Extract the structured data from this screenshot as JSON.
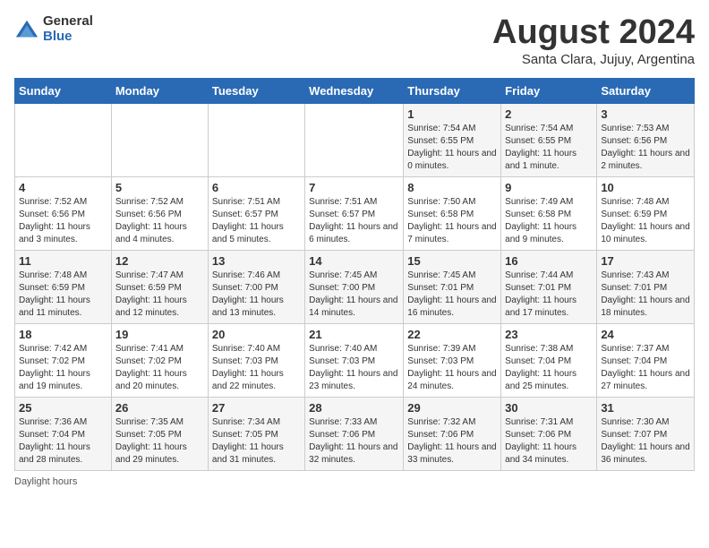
{
  "header": {
    "logo": {
      "general": "General",
      "blue": "Blue"
    },
    "title": "August 2024",
    "location": "Santa Clara, Jujuy, Argentina"
  },
  "days_of_week": [
    "Sunday",
    "Monday",
    "Tuesday",
    "Wednesday",
    "Thursday",
    "Friday",
    "Saturday"
  ],
  "footer": {
    "note": "Daylight hours"
  },
  "weeks": [
    {
      "days": [
        {
          "num": "",
          "info": ""
        },
        {
          "num": "",
          "info": ""
        },
        {
          "num": "",
          "info": ""
        },
        {
          "num": "",
          "info": ""
        },
        {
          "num": "1",
          "info": "Sunrise: 7:54 AM\nSunset: 6:55 PM\nDaylight: 11 hours and 0 minutes."
        },
        {
          "num": "2",
          "info": "Sunrise: 7:54 AM\nSunset: 6:55 PM\nDaylight: 11 hours and 1 minute."
        },
        {
          "num": "3",
          "info": "Sunrise: 7:53 AM\nSunset: 6:56 PM\nDaylight: 11 hours and 2 minutes."
        }
      ]
    },
    {
      "days": [
        {
          "num": "4",
          "info": "Sunrise: 7:52 AM\nSunset: 6:56 PM\nDaylight: 11 hours and 3 minutes."
        },
        {
          "num": "5",
          "info": "Sunrise: 7:52 AM\nSunset: 6:56 PM\nDaylight: 11 hours and 4 minutes."
        },
        {
          "num": "6",
          "info": "Sunrise: 7:51 AM\nSunset: 6:57 PM\nDaylight: 11 hours and 5 minutes."
        },
        {
          "num": "7",
          "info": "Sunrise: 7:51 AM\nSunset: 6:57 PM\nDaylight: 11 hours and 6 minutes."
        },
        {
          "num": "8",
          "info": "Sunrise: 7:50 AM\nSunset: 6:58 PM\nDaylight: 11 hours and 7 minutes."
        },
        {
          "num": "9",
          "info": "Sunrise: 7:49 AM\nSunset: 6:58 PM\nDaylight: 11 hours and 9 minutes."
        },
        {
          "num": "10",
          "info": "Sunrise: 7:48 AM\nSunset: 6:59 PM\nDaylight: 11 hours and 10 minutes."
        }
      ]
    },
    {
      "days": [
        {
          "num": "11",
          "info": "Sunrise: 7:48 AM\nSunset: 6:59 PM\nDaylight: 11 hours and 11 minutes."
        },
        {
          "num": "12",
          "info": "Sunrise: 7:47 AM\nSunset: 6:59 PM\nDaylight: 11 hours and 12 minutes."
        },
        {
          "num": "13",
          "info": "Sunrise: 7:46 AM\nSunset: 7:00 PM\nDaylight: 11 hours and 13 minutes."
        },
        {
          "num": "14",
          "info": "Sunrise: 7:45 AM\nSunset: 7:00 PM\nDaylight: 11 hours and 14 minutes."
        },
        {
          "num": "15",
          "info": "Sunrise: 7:45 AM\nSunset: 7:01 PM\nDaylight: 11 hours and 16 minutes."
        },
        {
          "num": "16",
          "info": "Sunrise: 7:44 AM\nSunset: 7:01 PM\nDaylight: 11 hours and 17 minutes."
        },
        {
          "num": "17",
          "info": "Sunrise: 7:43 AM\nSunset: 7:01 PM\nDaylight: 11 hours and 18 minutes."
        }
      ]
    },
    {
      "days": [
        {
          "num": "18",
          "info": "Sunrise: 7:42 AM\nSunset: 7:02 PM\nDaylight: 11 hours and 19 minutes."
        },
        {
          "num": "19",
          "info": "Sunrise: 7:41 AM\nSunset: 7:02 PM\nDaylight: 11 hours and 20 minutes."
        },
        {
          "num": "20",
          "info": "Sunrise: 7:40 AM\nSunset: 7:03 PM\nDaylight: 11 hours and 22 minutes."
        },
        {
          "num": "21",
          "info": "Sunrise: 7:40 AM\nSunset: 7:03 PM\nDaylight: 11 hours and 23 minutes."
        },
        {
          "num": "22",
          "info": "Sunrise: 7:39 AM\nSunset: 7:03 PM\nDaylight: 11 hours and 24 minutes."
        },
        {
          "num": "23",
          "info": "Sunrise: 7:38 AM\nSunset: 7:04 PM\nDaylight: 11 hours and 25 minutes."
        },
        {
          "num": "24",
          "info": "Sunrise: 7:37 AM\nSunset: 7:04 PM\nDaylight: 11 hours and 27 minutes."
        }
      ]
    },
    {
      "days": [
        {
          "num": "25",
          "info": "Sunrise: 7:36 AM\nSunset: 7:04 PM\nDaylight: 11 hours and 28 minutes."
        },
        {
          "num": "26",
          "info": "Sunrise: 7:35 AM\nSunset: 7:05 PM\nDaylight: 11 hours and 29 minutes."
        },
        {
          "num": "27",
          "info": "Sunrise: 7:34 AM\nSunset: 7:05 PM\nDaylight: 11 hours and 31 minutes."
        },
        {
          "num": "28",
          "info": "Sunrise: 7:33 AM\nSunset: 7:06 PM\nDaylight: 11 hours and 32 minutes."
        },
        {
          "num": "29",
          "info": "Sunrise: 7:32 AM\nSunset: 7:06 PM\nDaylight: 11 hours and 33 minutes."
        },
        {
          "num": "30",
          "info": "Sunrise: 7:31 AM\nSunset: 7:06 PM\nDaylight: 11 hours and 34 minutes."
        },
        {
          "num": "31",
          "info": "Sunrise: 7:30 AM\nSunset: 7:07 PM\nDaylight: 11 hours and 36 minutes."
        }
      ]
    }
  ]
}
